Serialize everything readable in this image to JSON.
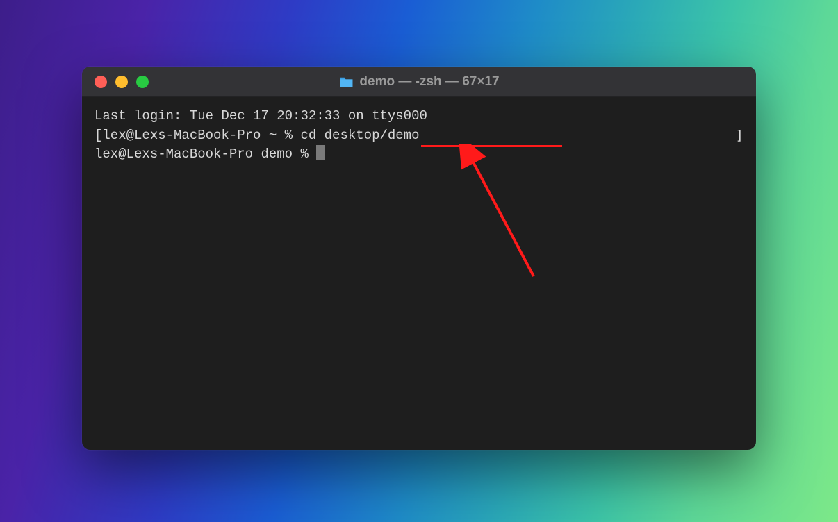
{
  "window": {
    "title": "demo — -zsh — 67×17"
  },
  "terminal": {
    "lines": [
      "Last login: Tue Dec 17 20:32:33 on ttys000",
      "[lex@Lexs-MacBook-Pro ~ % cd desktop/demo",
      "lex@Lexs-MacBook-Pro demo % "
    ],
    "bracket_right": "]"
  }
}
